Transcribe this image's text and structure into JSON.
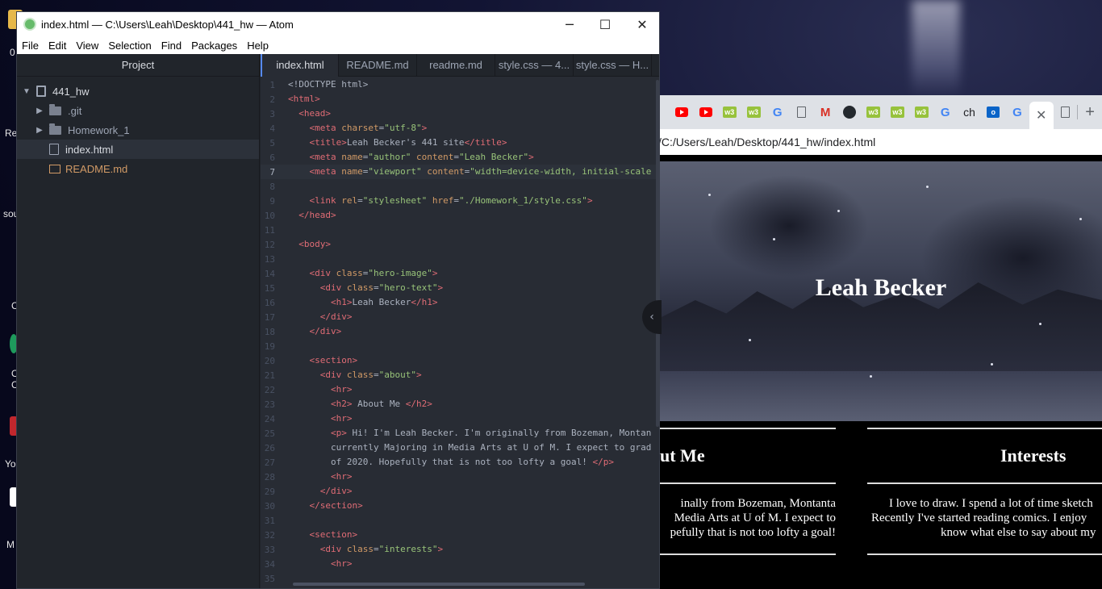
{
  "desktop": {
    "labels": [
      "0",
      "Re",
      "sou",
      "C",
      "O",
      "C",
      "Yo",
      "M"
    ]
  },
  "atom": {
    "title": "index.html — C:\\Users\\Leah\\Desktop\\441_hw — Atom",
    "menu": [
      "File",
      "Edit",
      "View",
      "Selection",
      "Find",
      "Packages",
      "Help"
    ],
    "tree": {
      "header": "Project",
      "items": [
        {
          "label": "441_hw",
          "type": "repo"
        },
        {
          "label": ".git",
          "type": "folder"
        },
        {
          "label": "Homework_1",
          "type": "folder"
        },
        {
          "label": "index.html",
          "type": "file"
        },
        {
          "label": "README.md",
          "type": "book"
        }
      ]
    },
    "tabs": [
      "index.html",
      "README.md",
      "readme.md",
      "style.css — 4...",
      "style.css — H..."
    ],
    "line_numbers": [
      "1",
      "2",
      "3",
      "4",
      "5",
      "6",
      "7",
      "8",
      "9",
      "10",
      "11",
      "12",
      "13",
      "14",
      "15",
      "16",
      "17",
      "18",
      "19",
      "20",
      "21",
      "22",
      "23",
      "24",
      "25",
      "26",
      "27",
      "28",
      "29",
      "30",
      "31",
      "32",
      "33",
      "34",
      "35"
    ]
  },
  "browser": {
    "url": "/C:/Users/Leah/Desktop/441_hw/index.html",
    "tabs_text": {
      "ch": "ch"
    },
    "page": {
      "hero_title": "Leah Becker",
      "about_heading": "ut Me",
      "about_lines": [
        "inally from Bozeman, Montanta",
        "Media Arts at U of M. I expect to",
        "pefully that is not too lofty a goal!"
      ],
      "interests_heading": "Interests",
      "interests_lines": [
        "I love to draw. I spend a lot of time sketch",
        "Recently I've started reading comics. I enjoy",
        "know what else to say about my"
      ]
    }
  },
  "colors": {
    "atom_bg": "#282c34",
    "tag": "#e06c75",
    "attr": "#d19a66",
    "string": "#98c379"
  }
}
